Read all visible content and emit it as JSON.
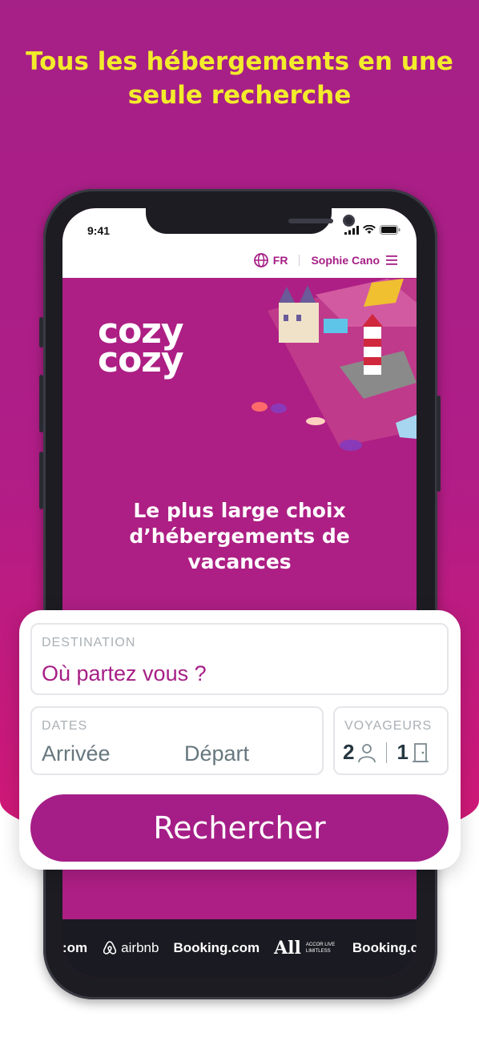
{
  "headline": {
    "line1": "Tous les hébergements en une",
    "line2": "seule recherche"
  },
  "status_bar": {
    "time": "9:41"
  },
  "nav": {
    "language": "FR",
    "user_name": "Sophie Cano"
  },
  "brand": {
    "logo_line1": "cozy",
    "logo_line2": "cozy"
  },
  "hero": {
    "line1": "Le plus large choix",
    "line2": "d’hébergements de",
    "line3": "vacances"
  },
  "search": {
    "destination_label": "DESTINATION",
    "destination_placeholder": "Où partez vous ?",
    "dates_label": "DATES",
    "arrival": "Arrivée",
    "departure": "Départ",
    "travelers_label": "VOYAGEURS",
    "guests": "2",
    "rooms": "1",
    "submit_label": "Rechercher"
  },
  "partners": [
    ":om",
    "airbnb",
    "Booking.com",
    "All",
    "Booking.co"
  ],
  "partner_accor_text": "ACCOR LIVE LIMITLESS",
  "colors": {
    "brand": "#a51e87",
    "headline": "#f3ec2b"
  }
}
